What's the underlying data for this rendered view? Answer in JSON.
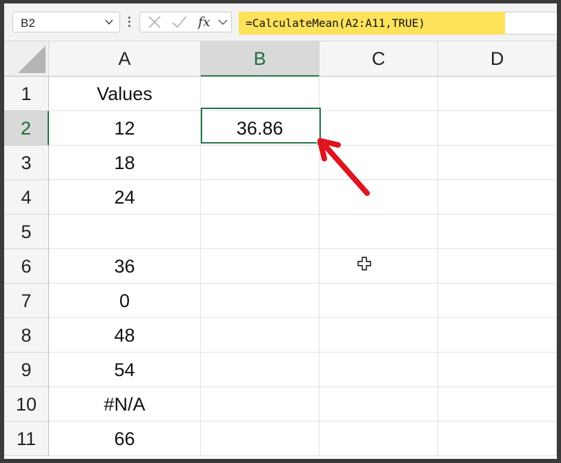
{
  "name_box": {
    "value": "B2",
    "dropdown_icon": "chevron-down-icon"
  },
  "formula_bar": {
    "cancel_icon": "close-icon",
    "enter_icon": "checkmark-icon",
    "fx_label": "fx",
    "fx_dropdown_icon": "chevron-down-icon",
    "formula": "=CalculateMean(A2:A11,TRUE)",
    "highlight_color": "#fde25a"
  },
  "columns": [
    "A",
    "B",
    "C",
    "D"
  ],
  "selected_column": "B",
  "rows": [
    {
      "num": "1",
      "cells": [
        "Values",
        "",
        "",
        ""
      ]
    },
    {
      "num": "2",
      "cells": [
        "12",
        "36.86",
        "",
        ""
      ]
    },
    {
      "num": "3",
      "cells": [
        "18",
        "",
        "",
        ""
      ]
    },
    {
      "num": "4",
      "cells": [
        "24",
        "",
        "",
        ""
      ]
    },
    {
      "num": "5",
      "cells": [
        "",
        "",
        "",
        ""
      ]
    },
    {
      "num": "6",
      "cells": [
        "36",
        "",
        "",
        ""
      ]
    },
    {
      "num": "7",
      "cells": [
        "0",
        "",
        "",
        ""
      ]
    },
    {
      "num": "8",
      "cells": [
        "48",
        "",
        "",
        ""
      ]
    },
    {
      "num": "9",
      "cells": [
        "54",
        "",
        "",
        ""
      ]
    },
    {
      "num": "10",
      "cells": [
        "#N/A",
        "",
        "",
        ""
      ]
    },
    {
      "num": "11",
      "cells": [
        "66",
        "",
        "",
        ""
      ]
    }
  ],
  "selected_row": "2",
  "active_cell": "B2",
  "accent_color": "#217346",
  "annotation": {
    "arrow_color": "#e0141e",
    "arrow_icon": "red-arrow-icon"
  },
  "cursor_icon": "cell-select-cross-icon"
}
